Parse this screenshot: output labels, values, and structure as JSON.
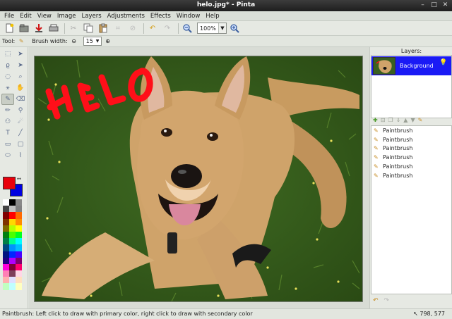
{
  "window": {
    "title": "helo.jpg* - Pinta",
    "controls": [
      "–",
      "□",
      "✕"
    ]
  },
  "menu": [
    "File",
    "Edit",
    "View",
    "Image",
    "Layers",
    "Adjustments",
    "Effects",
    "Window",
    "Help"
  ],
  "toolbar": {
    "buttons": [
      "new-icon",
      "open-icon",
      "save-icon",
      "print-icon",
      "cut-icon",
      "copy-icon",
      "paste-icon",
      "crop-icon",
      "deselect-icon",
      "undo-icon",
      "redo-icon",
      "zoom-out-icon",
      "zoom-in-icon"
    ],
    "zoom_value": "100%"
  },
  "tool_options": {
    "tool_label": "Tool:",
    "brush_width_label": "Brush width:",
    "brush_width_value": "15"
  },
  "tools": [
    "rectangle-select",
    "move-selection",
    "lasso-select",
    "move-selected",
    "ellipse-select",
    "zoom",
    "magic-wand",
    "pan",
    "paintbrush",
    "eraser",
    "pencil",
    "color-picker",
    "clone-stamp",
    "recolor",
    "text",
    "line",
    "rectangle",
    "rounded-rectangle",
    "ellipse",
    "freeform-shape"
  ],
  "active_tool": "paintbrush",
  "colors": {
    "primary": "#e8000b",
    "secondary": "#0000e0",
    "accent_selection": "#1a1af5"
  },
  "palette": [
    "#ffffff",
    "#000000",
    "#888888",
    "#444444",
    "#c0c0c0",
    "#808080",
    "#7f0000",
    "#ff0000",
    "#ff6a00",
    "#7f3300",
    "#ffd800",
    "#ff8c00",
    "#7f6a00",
    "#b6ff00",
    "#ffff00",
    "#007f0e",
    "#4cff00",
    "#00ff21",
    "#007f46",
    "#00ff90",
    "#00ffff",
    "#00497f",
    "#0094ff",
    "#00c0ff",
    "#00137f",
    "#0026ff",
    "#4800ff",
    "#21007f",
    "#b200ff",
    "#7f006e",
    "#ff00dc",
    "#7f0037",
    "#ff006e",
    "#ff7fb6",
    "#7f3f5b",
    "#ffd6e6",
    "#ffb0b0",
    "#e0e0ff",
    "#ffe0c0",
    "#c0ffc0",
    "#c0ffff",
    "#ffffc0"
  ],
  "canvas": {
    "drawn_text": "HELO"
  },
  "layers": {
    "title": "Layers:",
    "items": [
      {
        "name": "Background"
      }
    ]
  },
  "history": {
    "items": [
      "Paintbrush",
      "Paintbrush",
      "Paintbrush",
      "Paintbrush",
      "Paintbrush",
      "Paintbrush"
    ]
  },
  "status": {
    "message": "Paintbrush: Left click to draw with primary color, right click to draw with secondary color",
    "position": "798, 577"
  }
}
